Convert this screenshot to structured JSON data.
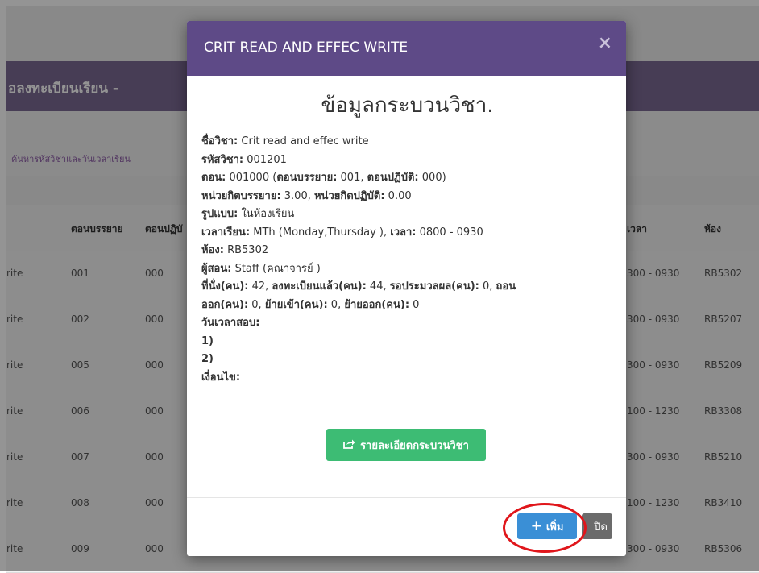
{
  "background": {
    "header_title": "อลงทะเบียนเรียน -",
    "search_link": "ค้นหารหัสวิชาและวันเวลาเรียน",
    "columns": [
      "ตอนบรรยาย",
      "ตอนปฏิบั",
      "เวลา",
      "ห้อง"
    ],
    "rows": [
      {
        "name": "rite",
        "lecture": "001",
        "lab": "000",
        "time": "300 - 0930",
        "room": "RB5302"
      },
      {
        "name": "rite",
        "lecture": "002",
        "lab": "000",
        "time": "300 - 0930",
        "room": "RB5207"
      },
      {
        "name": "rite",
        "lecture": "005",
        "lab": "000",
        "time": "300 - 0930",
        "room": "RB5209"
      },
      {
        "name": "rite",
        "lecture": "006",
        "lab": "000",
        "time": "100 - 1230",
        "room": "RB3308"
      },
      {
        "name": "rite",
        "lecture": "007",
        "lab": "000",
        "time": "300 - 0930",
        "room": "RB5210"
      },
      {
        "name": "rite",
        "lecture": "008",
        "lab": "000",
        "time": "100 - 1230",
        "room": "RB3410"
      },
      {
        "name": "rite",
        "lecture": "009",
        "lab": "000",
        "time": "300 - 0930",
        "room": "RB5306"
      }
    ]
  },
  "modal": {
    "title": "CRIT READ AND EFFEC WRITE",
    "close_symbol": "×",
    "info_title": "ข้อมูลกระบวนวิชา.",
    "lines": {
      "course_name": {
        "label": "ชื่อวิชา:",
        "value": " Crit read and effec write"
      },
      "course_code": {
        "label": "รหัสวิชา:",
        "value": " 001201"
      },
      "section": {
        "l1": "ตอน:",
        "v1": " 001000 (",
        "l2": "ตอนบรรยาย:",
        "v2": " 001, ",
        "l3": "ตอนปฏิบัติ:",
        "v3": " 000)"
      },
      "credits": {
        "l1": "หน่วยกิตบรรยาย:",
        "v1": " 3.00, ",
        "l2": "หน่วยกิตปฏิบัติ:",
        "v2": " 0.00"
      },
      "format": {
        "label": "รูปแบบ:",
        "value": " ในห้องเรียน"
      },
      "schedule": {
        "l1": "เวลาเรียน:",
        "v1": " MTh (Monday,Thursday ), ",
        "l2": "เวลา:",
        "v2": " 0800 - 0930"
      },
      "room": {
        "label": "ห้อง:",
        "value": " RB5302"
      },
      "instructor": {
        "label": "ผู้สอน:",
        "value": " Staff (คณาจารย์ )"
      },
      "seats1": {
        "l1": "ที่นั่ง(คน):",
        "v1": " 42, ",
        "l2": "ลงทะเบียนแล้ว(คน):",
        "v2": " 44, ",
        "l3": "รอประมวลผล(คน):",
        "v3": " 0, ",
        "l4": "ถอน"
      },
      "seats2": {
        "l1": "ออก(คน):",
        "v1": " 0, ",
        "l2": "ย้ายเข้า(คน):",
        "v2": " 0, ",
        "l3": "ย้ายออก(คน):",
        "v3": " 0"
      },
      "exam_label": "วันเวลาสอบ:",
      "exam_1": "1)",
      "exam_2": "2)",
      "condition_label": "เงื่อนไข:"
    },
    "detail_button": "รายละเอียดกระบวนวิชา",
    "add_button": "เพิ่ม",
    "close_button": "ปิด"
  },
  "colors": {
    "modal_header": "#5e4a87",
    "detail_button": "#3dbc74",
    "add_button": "#3a8fd6",
    "highlight_ring": "#e0161b"
  }
}
